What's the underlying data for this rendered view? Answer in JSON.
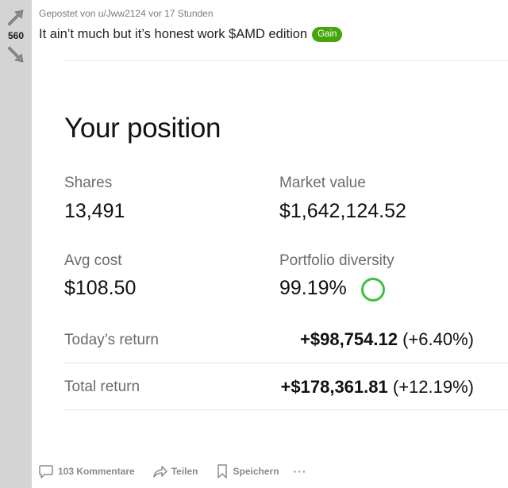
{
  "vote": {
    "count": "560"
  },
  "post": {
    "meta_prefix": "Gepostet von",
    "author": "u/Jww2124",
    "time": "vor 17 Stunden",
    "title": "It ain’t much but it’s honest work $AMD edition",
    "flair": "Gain"
  },
  "position": {
    "heading": "Your position",
    "shares_label": "Shares",
    "shares_value": "13,491",
    "market_value_label": "Market value",
    "market_value": "$1,642,124.52",
    "avg_cost_label": "Avg cost",
    "avg_cost_value": "$108.50",
    "diversity_label": "Portfolio diversity",
    "diversity_value": "99.19%",
    "todays_return_label": "Today’s return",
    "todays_return_amount": "+$98,754.12",
    "todays_return_pct": "(+6.40%)",
    "total_return_label": "Total return",
    "total_return_amount": "+$178,361.81",
    "total_return_pct": "(+12.19%)"
  },
  "actions": {
    "comments": "103 Kommentare",
    "share": "Teilen",
    "save": "Speichern",
    "more": "···"
  },
  "colors": {
    "flair_bg": "#46a508",
    "diversity_ring": "#3fbf3f",
    "rail_bg": "#d4d4d4"
  },
  "icons": [
    "upvote-icon",
    "downvote-icon",
    "comment-icon",
    "share-icon",
    "bookmark-icon",
    "more-icon"
  ]
}
